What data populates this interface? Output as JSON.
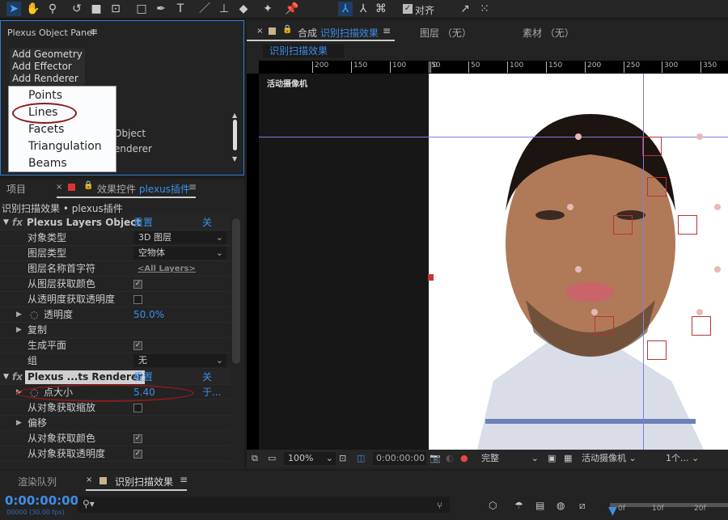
{
  "toolbar": {
    "snap_label": "对齐",
    "icons": [
      "selection-tool",
      "hand-tool",
      "zoom-tool",
      "rotate-tool",
      "camera-tool",
      "pan-behind-tool",
      "rectangle-tool",
      "pen-tool",
      "type-tool",
      "brush-tool",
      "clone-stamp-tool",
      "eraser-tool",
      "roto-brush-tool",
      "puppet-pin-tool"
    ]
  },
  "plexus_panel": {
    "title": "Plexus Object Panel",
    "buttons": [
      "Add Geometry",
      "Add Effector",
      "Add Renderer"
    ],
    "menu": [
      "Points",
      "Lines",
      "Facets",
      "Triangulation",
      "Beams"
    ],
    "behind": [
      "Object",
      "enderer"
    ]
  },
  "effects": {
    "tab_project": "项目",
    "tab_label": "效果控件",
    "tab_layer": "plexus插件",
    "breadcrumb": "识别扫描效果 • plexus插件",
    "groups": [
      {
        "name": "Plexus Layers Object",
        "reset": "重置",
        "about": "关于...",
        "rows": [
          {
            "label": "对象类型",
            "type": "select",
            "value": "3D 图层"
          },
          {
            "label": "图层类型",
            "type": "select",
            "value": "空物体"
          },
          {
            "label": "图层名称首字符",
            "type": "link",
            "value": "<All Layers>"
          },
          {
            "label": "从图层获取颜色",
            "type": "checkbox",
            "checked": true
          },
          {
            "label": "从透明度获取透明度",
            "type": "checkbox",
            "checked": false
          },
          {
            "label": "透明度",
            "type": "number",
            "value": "50.0",
            "unit": "%"
          },
          {
            "label": "复制",
            "type": "group"
          },
          {
            "label": "生成平面",
            "type": "checkbox",
            "checked": true
          },
          {
            "label": "组",
            "type": "select",
            "value": "无"
          }
        ]
      },
      {
        "name": "Plexus ...ts Renderer",
        "reset": "重置",
        "about": "关于...",
        "rows": [
          {
            "label": "点大小",
            "type": "number",
            "value": "5.40"
          },
          {
            "label": "从对象获取缩放",
            "type": "checkbox",
            "checked": false
          },
          {
            "label": "偏移",
            "type": "group"
          },
          {
            "label": "从对象获取颜色",
            "type": "checkbox",
            "checked": true
          },
          {
            "label": "从对象获取透明度",
            "type": "checkbox",
            "checked": true
          }
        ]
      }
    ]
  },
  "comp": {
    "tab_prefix": "合成",
    "tab_name": "识别扫描效果",
    "layer_tab": "图层 （无）",
    "footage_tab": "素材 （无）",
    "subtab": "识别扫描效果",
    "camera_label": "活动摄像机",
    "ruler": [
      "200",
      "150",
      "100",
      "50",
      "0",
      "50",
      "100",
      "150",
      "200",
      "250",
      "300",
      "350"
    ],
    "zoom": "100%",
    "timecode": "0:00:00:00",
    "resolution": "完整",
    "camera_select": "活动摄像机",
    "views": "1个..."
  },
  "timeline": {
    "tab_render": "渲染队列",
    "tab_comp": "识别扫描效果",
    "timecode": "0:00:00:00",
    "fps": "00000 (30.00 fps)",
    "search_placeholder": "",
    "ticks": [
      "0f",
      "10f",
      "20f"
    ]
  },
  "colors": {
    "accent": "#3d8ee8",
    "highlight": "#8b1a1a",
    "panel_border": "#2d7ed8"
  }
}
